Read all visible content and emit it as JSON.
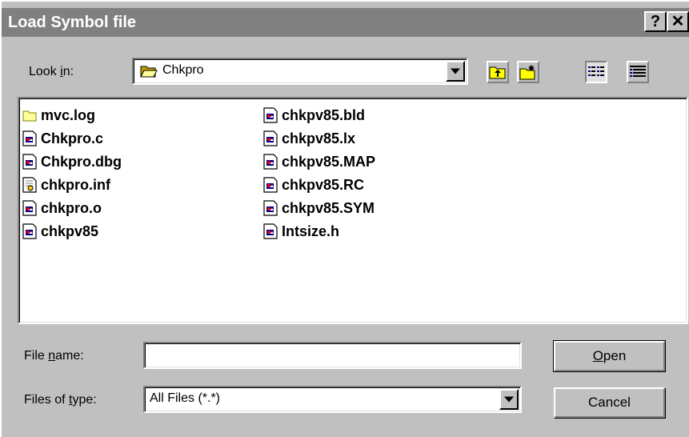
{
  "dialog": {
    "title": "Load Symbol file",
    "help_glyph": "?",
    "close_glyph": "✕"
  },
  "look_in": {
    "label_pre": "Look ",
    "label_accel": "i",
    "label_post": "n:",
    "value": "Chkpro"
  },
  "toolbar": {
    "up_folder_icon": "up-folder-icon",
    "new_folder_icon": "new-folder-icon",
    "list_view_icon": "list-view-icon",
    "details_view_icon": "details-view-icon"
  },
  "files": [
    {
      "name": "mvc.log",
      "icon": "folder"
    },
    {
      "name": "Chkpro.c",
      "icon": "file"
    },
    {
      "name": "Chkpro.dbg",
      "icon": "file"
    },
    {
      "name": "chkpro.inf",
      "icon": "inf"
    },
    {
      "name": "chkpro.o",
      "icon": "file"
    },
    {
      "name": "chkpv85",
      "icon": "file"
    },
    {
      "name": "chkpv85.bld",
      "icon": "file"
    },
    {
      "name": "chkpv85.lx",
      "icon": "file"
    },
    {
      "name": "chkpv85.MAP",
      "icon": "file"
    },
    {
      "name": "chkpv85.RC",
      "icon": "file"
    },
    {
      "name": "chkpv85.SYM",
      "icon": "file"
    },
    {
      "name": "Intsize.h",
      "icon": "file"
    }
  ],
  "file_name": {
    "label_pre": "File ",
    "label_accel": "n",
    "label_post": "ame:",
    "value": ""
  },
  "file_type": {
    "label_pre": "Files of ",
    "label_accel": "t",
    "label_post": "ype:",
    "value": "All Files (*.*)"
  },
  "buttons": {
    "open_accel": "O",
    "open_rest": "pen",
    "cancel": "Cancel"
  },
  "colors": {
    "title_bar": "#808080",
    "face": "#c0c0c0",
    "field": "#ffffff"
  }
}
